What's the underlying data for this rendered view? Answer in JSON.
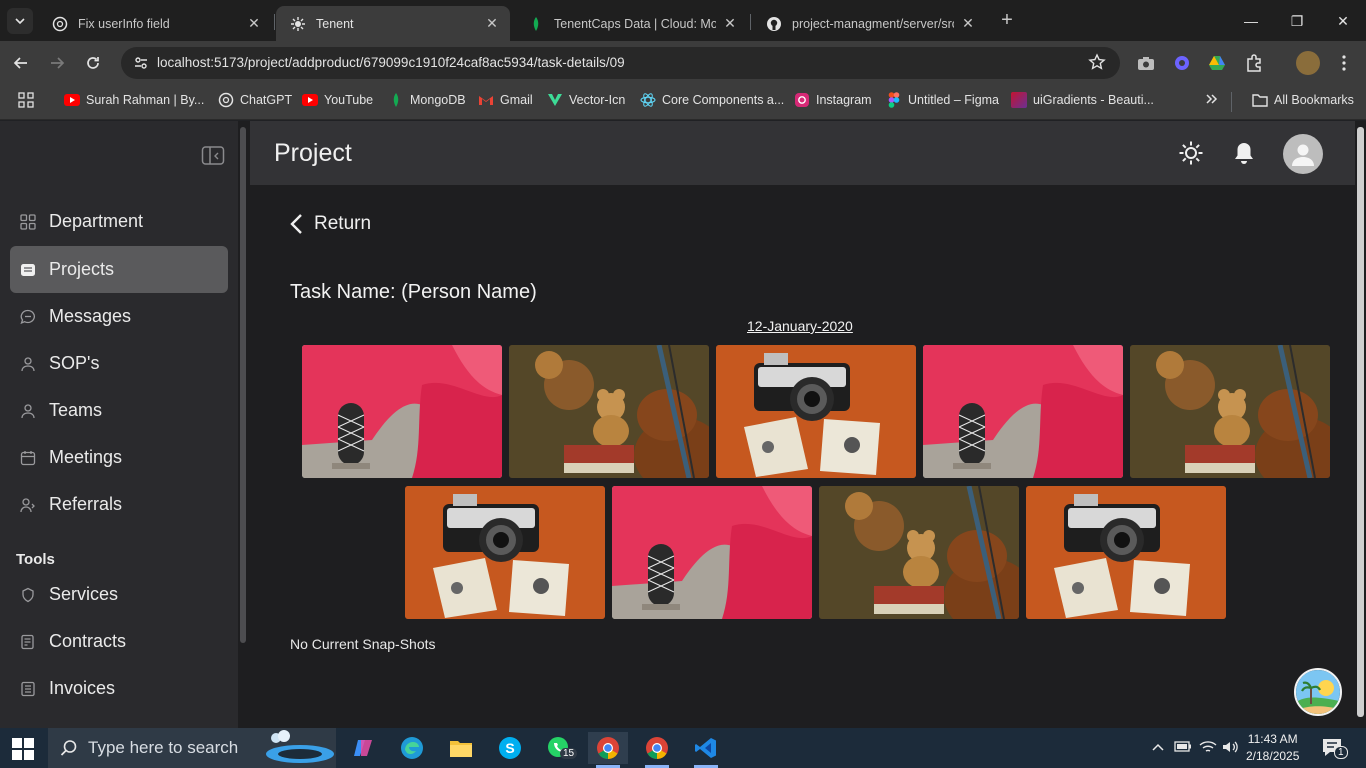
{
  "browser": {
    "tabs": [
      {
        "title": "Fix userInfo field",
        "favicon": "chatgpt-icon"
      },
      {
        "title": "Tenent",
        "favicon": "tenent-icon"
      },
      {
        "title": "TenentCaps Data | Cloud: Mong",
        "favicon": "mongodb-icon"
      },
      {
        "title": "project-managment/server/src/",
        "favicon": "github-icon"
      }
    ],
    "url": "localhost:5173/project/addproduct/679099c1910f24caf8ac5934/task-details/09",
    "bookmarks": [
      {
        "label": "Surah Rahman | By...",
        "icon": "youtube-icon"
      },
      {
        "label": "ChatGPT",
        "icon": "chatgpt-icon"
      },
      {
        "label": "YouTube",
        "icon": "youtube-icon"
      },
      {
        "label": "MongoDB",
        "icon": "mongodb-icon"
      },
      {
        "label": "Gmail",
        "icon": "gmail-icon"
      },
      {
        "label": "Vector-Icn",
        "icon": "vector-icon"
      },
      {
        "label": "Core Components a...",
        "icon": "react-icon"
      },
      {
        "label": "Instagram",
        "icon": "instagram-icon"
      },
      {
        "label": "Untitled – Figma",
        "icon": "figma-icon"
      },
      {
        "label": "uiGradients - Beauti...",
        "icon": "uigradients-icon"
      }
    ],
    "all_bookmarks": "All Bookmarks"
  },
  "sidebar": {
    "items": [
      {
        "label": "Department",
        "icon": "grid-icon",
        "active": false
      },
      {
        "label": "Projects",
        "icon": "folder-icon",
        "active": true
      },
      {
        "label": "Messages",
        "icon": "chat-icon",
        "active": false
      },
      {
        "label": "SOP's",
        "icon": "person-icon",
        "active": false
      },
      {
        "label": "Teams",
        "icon": "person-icon",
        "active": false
      },
      {
        "label": "Meetings",
        "icon": "calendar-icon",
        "active": false
      },
      {
        "label": "Referrals",
        "icon": "referral-icon",
        "active": false
      }
    ],
    "tools_title": "Tools",
    "tools": [
      {
        "label": "Services",
        "icon": "services-icon"
      },
      {
        "label": "Contracts",
        "icon": "contract-icon"
      },
      {
        "label": "Invoices",
        "icon": "invoice-icon"
      }
    ]
  },
  "header": {
    "title": "Project"
  },
  "main": {
    "return_label": "Return",
    "task_name": "Task Name: (Person Name)",
    "date": "12-January-2020",
    "images": [
      "ivy-window",
      "violin-teddy",
      "camera-photos",
      "ivy-window",
      "violin-teddy",
      "camera-photos",
      "ivy-window",
      "violin-teddy",
      "camera-photos"
    ],
    "empty_message": "No Current Snap-Shots"
  },
  "taskbar": {
    "search_placeholder": "Type here to search",
    "time": "11:43 AM",
    "date": "2/18/2025",
    "whatsapp_badge": "15",
    "notifications_count": "1"
  },
  "colors": {
    "sidebar_bg": "#2a2a2d",
    "active_item_bg": "#5a5a5c",
    "content_bg": "#1e1e20",
    "topbar_bg": "#333336"
  }
}
